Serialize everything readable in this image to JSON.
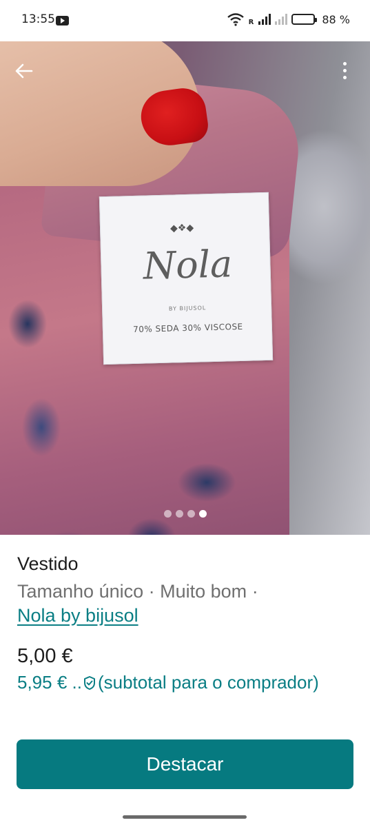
{
  "status_bar": {
    "time": "13:55",
    "battery_text": "88 %",
    "battery_level": 0.88
  },
  "photo": {
    "label_brand": "Nola",
    "label_sub": "BY BIJUSOL",
    "label_composition": "70% SEDA 30% VISCOSE",
    "carousel_count": 4,
    "carousel_active_index": 3
  },
  "item": {
    "title": "Vestido",
    "size": "Tamanho único",
    "separator": " · ",
    "condition": "Muito bom",
    "brand": "Nola by bijusol",
    "price": "5,00 €",
    "total_price": "5,95 € ..",
    "total_note": "(subtotal para o comprador)"
  },
  "actions": {
    "promote_label": "Destacar"
  },
  "colors": {
    "accent": "#067a80",
    "link": "#0a7e84"
  },
  "icons": [
    "youtube-icon",
    "wifi-icon",
    "signal-icon",
    "battery-icon",
    "back-arrow-icon",
    "more-vert-icon",
    "shield-check-icon"
  ]
}
